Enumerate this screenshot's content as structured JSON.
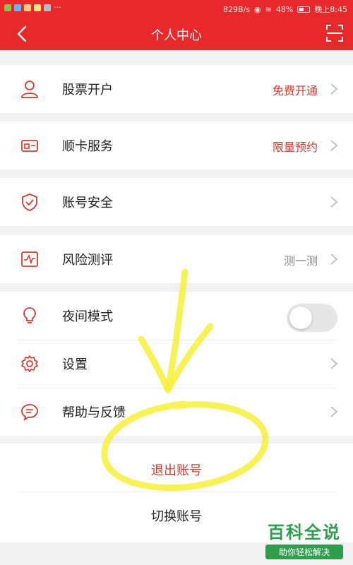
{
  "status_bar": {
    "net_speed": "829B/s",
    "battery": "48%",
    "time": "晚上8:45"
  },
  "header": {
    "title": "个人中心",
    "accent_color": "#e8292b"
  },
  "menu": {
    "stock_account": {
      "label": "股票开户",
      "value": "免费开通"
    },
    "card_service": {
      "label": "顺卡服务",
      "value": "限量预约"
    },
    "account_security": {
      "label": "账号安全"
    },
    "risk_assessment": {
      "label": "风险测评",
      "value": "测一测"
    },
    "night_mode": {
      "label": "夜间模式",
      "enabled": false
    },
    "settings": {
      "label": "设置"
    },
    "help_feedback": {
      "label": "帮助与反馈"
    }
  },
  "actions": {
    "logout": "退出账号",
    "switch_account": "切换账号"
  },
  "watermark": {
    "title": "百科全说",
    "subtitle": "助你轻松解决"
  }
}
